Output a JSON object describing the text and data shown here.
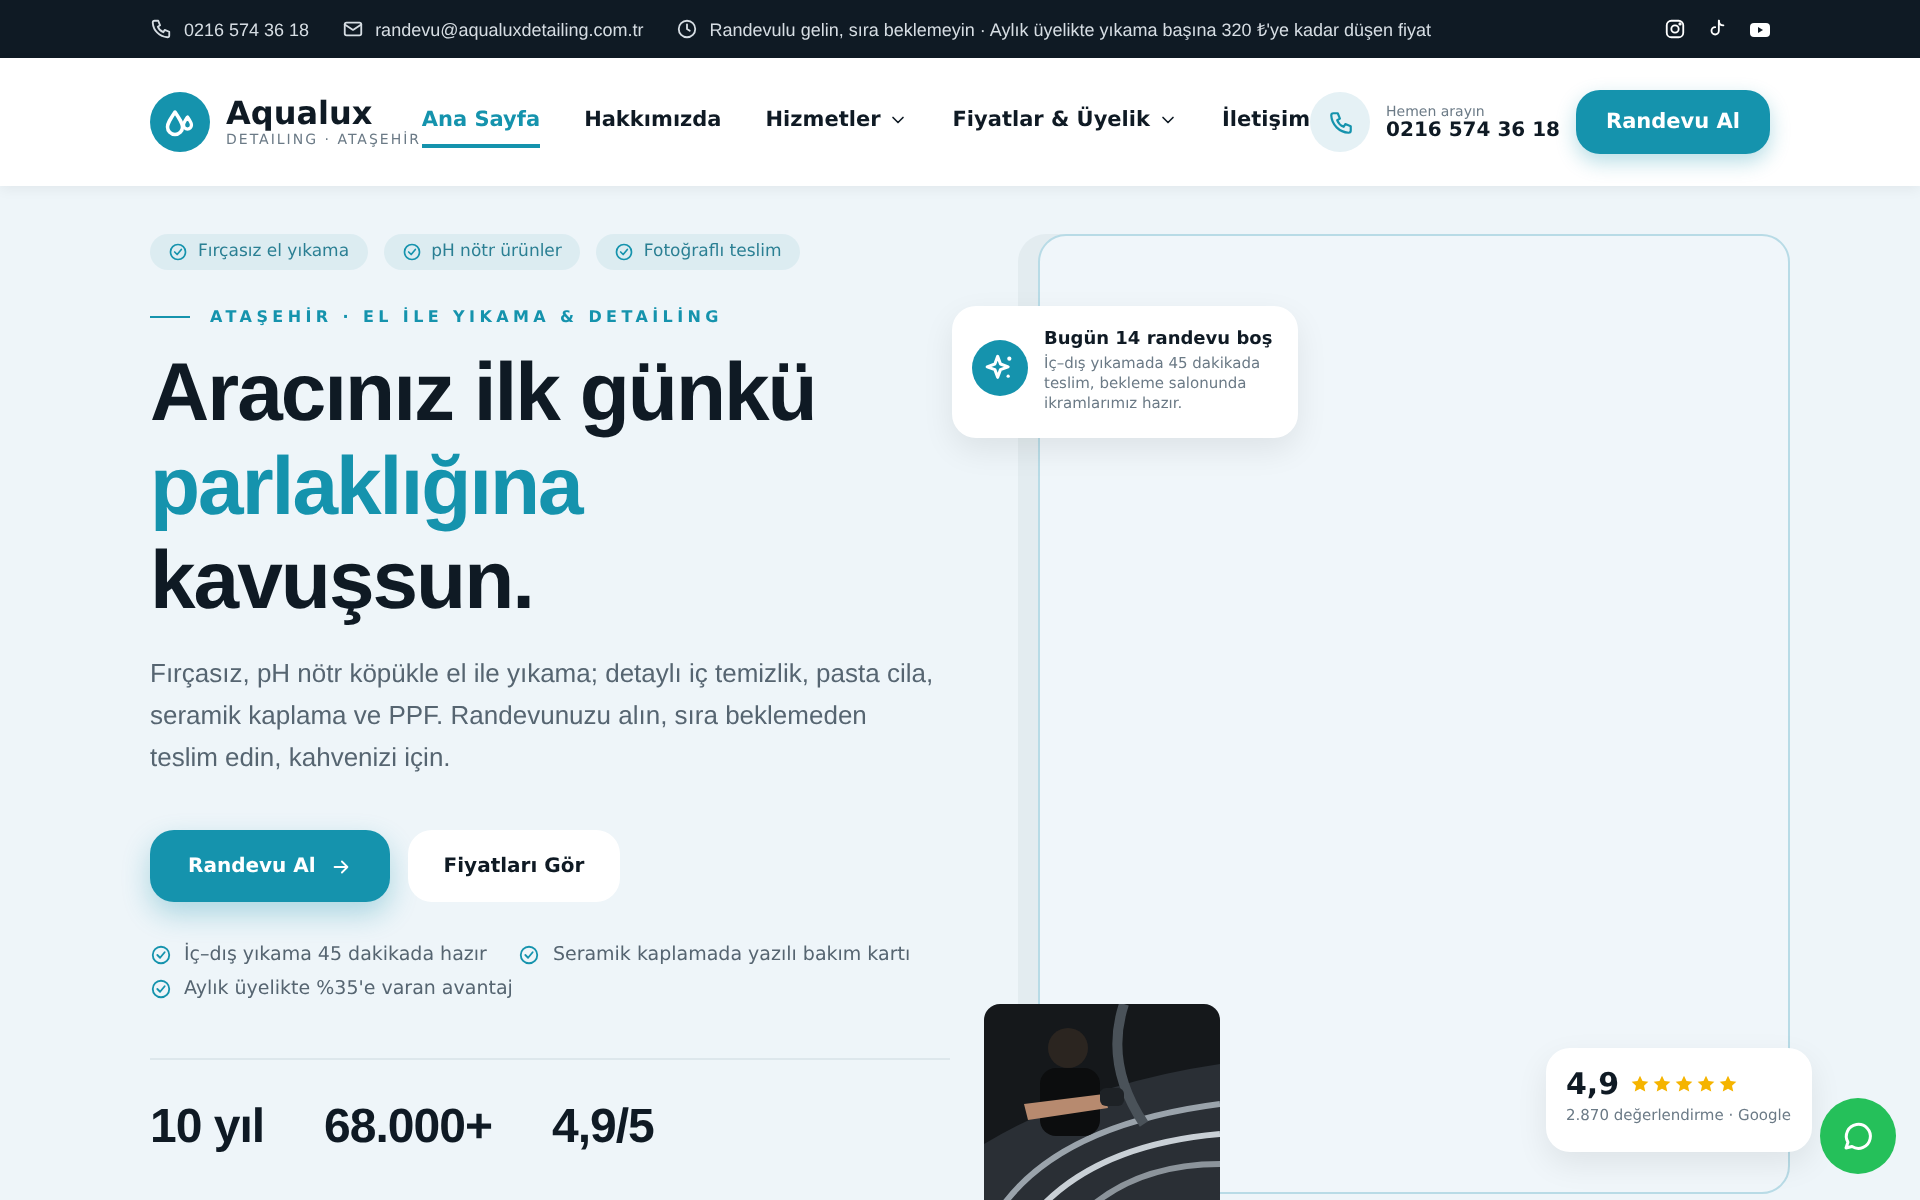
{
  "topbar": {
    "phone": "0216 574 36 18",
    "email": "randevu@aqualuxdetailing.com.tr",
    "notice": "Randevulu gelin, sıra beklemeyin · Aylık üyelikte yıkama başına 320 ₺'ye kadar düşen fiyat"
  },
  "brand": {
    "name": "Aqualux",
    "tagline": "DETAILING · ATAŞEHİR"
  },
  "nav": [
    {
      "label": "Ana Sayfa",
      "selected": true,
      "dropdown": false
    },
    {
      "label": "Hakkımızda",
      "selected": false,
      "dropdown": false
    },
    {
      "label": "Hizmetler",
      "selected": false,
      "dropdown": true
    },
    {
      "label": "Fiyatlar & Üyelik",
      "selected": false,
      "dropdown": true
    },
    {
      "label": "İletişim",
      "selected": false,
      "dropdown": false
    }
  ],
  "call": {
    "caption": "Hemen arayın",
    "phone": "0216 574 36 18"
  },
  "cta": "Randevu Al",
  "hero": {
    "chips": [
      "Fırçasız el yıkama",
      "pH nötr ürünler",
      "Fotoğraflı teslim"
    ],
    "eyebrow": "ATAŞEHİR · EL İLE YIKAMA & DETAİLİNG",
    "headline": [
      {
        "text": "Aracınız ilk günkü",
        "accent": false
      },
      {
        "text": "parlaklığına",
        "accent": true
      },
      {
        "text": "kavuşsun.",
        "accent": false
      }
    ],
    "lead": "Fırçasız, pH nötr köpükle el ile yıkama; detaylı iç temizlik, pasta cila, seramik kaplama ve PPF. Randevunuzu alın, sıra beklemeden teslim edin, kahvenizi için.",
    "primary": "Randevu Al",
    "secondary": "Fiyatları Gör",
    "checks": [
      "İç–dış yıkama 45 dakikada hazır",
      "Seramik kaplamada yazılı bakım kartı",
      "Aylık üyelikte %35'e varan avantaj"
    ],
    "stats": [
      "10 yıl",
      "68.000+",
      "4,9/5"
    ]
  },
  "notice_card": {
    "title": "Bugün 14 randevu boş",
    "text": "İç–dış yıkamada 45 dakikada teslim, bekleme salonunda ikramlarımız hazır."
  },
  "rating": {
    "score": "4,9",
    "stars": 5,
    "caption": "2.870 değerlendirme · Google"
  }
}
